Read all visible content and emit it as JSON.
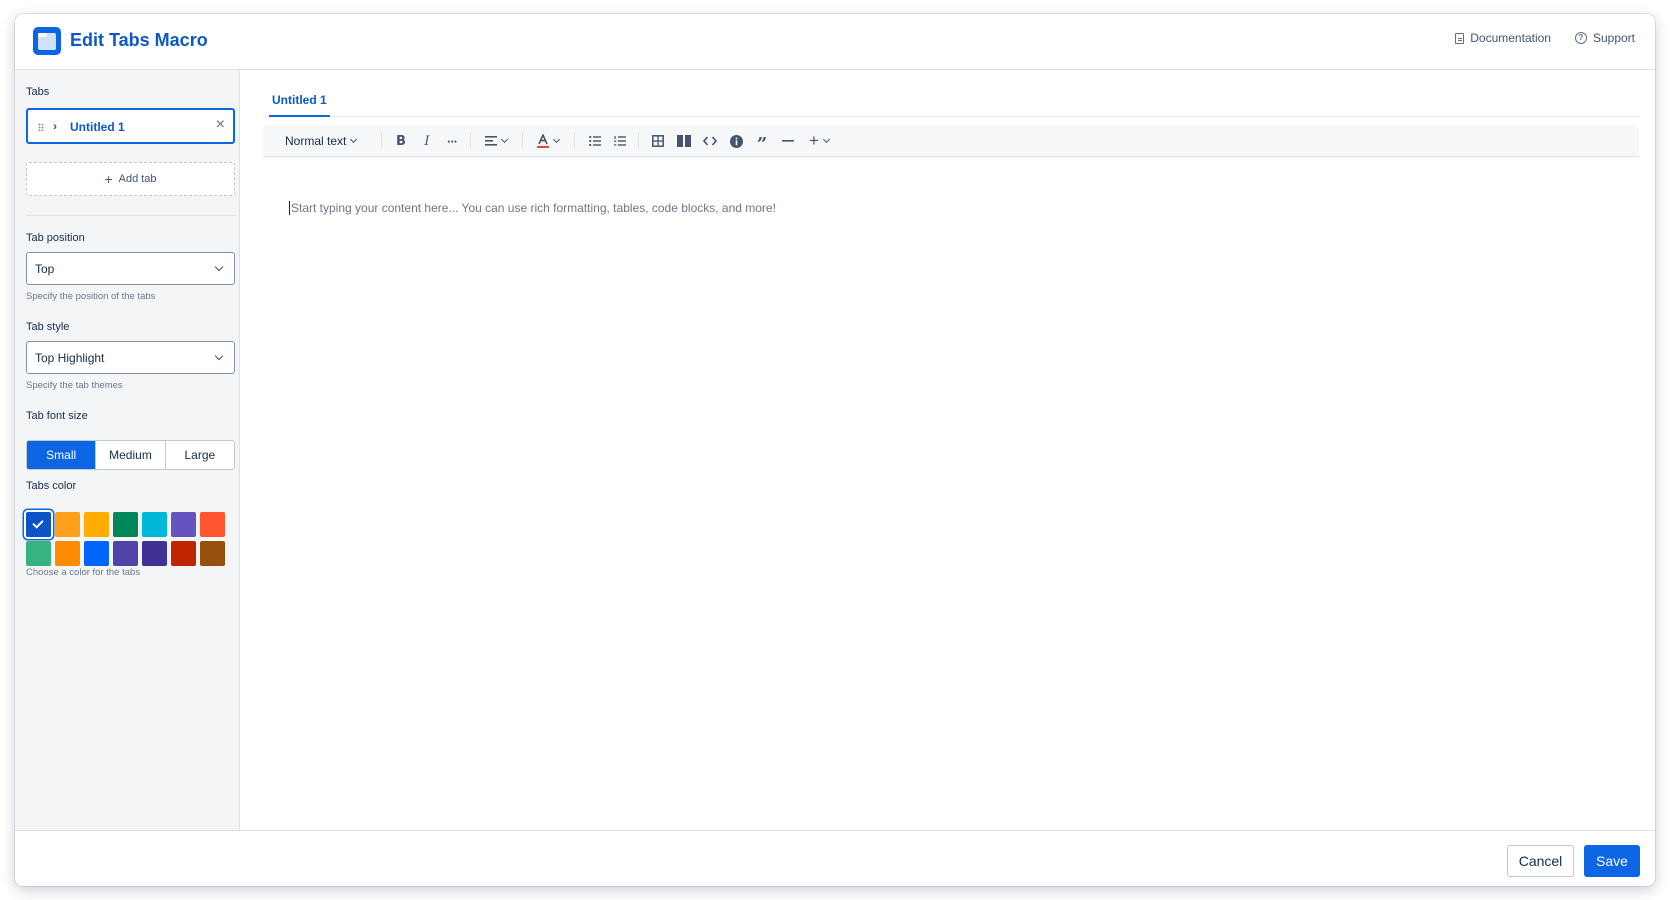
{
  "header": {
    "title": "Edit Tabs Macro",
    "documentation": "Documentation",
    "support": "Support",
    "support_icon_glyph": "?"
  },
  "sidebar": {
    "tabs_label": "Tabs",
    "tabs": [
      {
        "label": "Untitled 1"
      }
    ],
    "add_tab_label": "Add tab",
    "tab_position": {
      "label": "Tab position",
      "value": "Top",
      "help": "Specify the position of the tabs"
    },
    "tab_style": {
      "label": "Tab style",
      "value": "Top Highlight",
      "help": "Specify the tab themes"
    },
    "font_size": {
      "label": "Tab font size",
      "options": [
        "Small",
        "Medium",
        "Large"
      ],
      "selected": "Small"
    },
    "tabs_color": {
      "label": "Tabs color",
      "help": "Choose a color for the tabs",
      "selected_index": 0,
      "colors": [
        "#0c52c9",
        "#ff9f1a",
        "#ffab00",
        "#00875a",
        "#00b8d9",
        "#6554c0",
        "#ff5630",
        "#36b37e",
        "#ff8b00",
        "#0065ff",
        "#5243aa",
        "#403294",
        "#bf2600",
        "#974f0c"
      ]
    }
  },
  "main": {
    "active_tab": "Untitled 1",
    "toolbar": {
      "text_style": "Normal text",
      "icons": [
        "bold-icon",
        "italic-icon",
        "more-formatting-icon",
        "align-icon",
        "text-color-icon",
        "bullet-list-icon",
        "numbered-list-icon",
        "table-icon",
        "layout-icon",
        "code-icon",
        "info-panel-icon",
        "quote-icon",
        "divider-icon",
        "insert-plus-icon"
      ]
    },
    "editor_placeholder": "Start typing your content here... You can use rich formatting, tables, code blocks, and more!"
  },
  "footer": {
    "cancel": "Cancel",
    "save": "Save"
  },
  "colors": {
    "accent": "#0c66e4",
    "title": "#0c58c9",
    "sidebar_bg": "#f4f5f7"
  }
}
